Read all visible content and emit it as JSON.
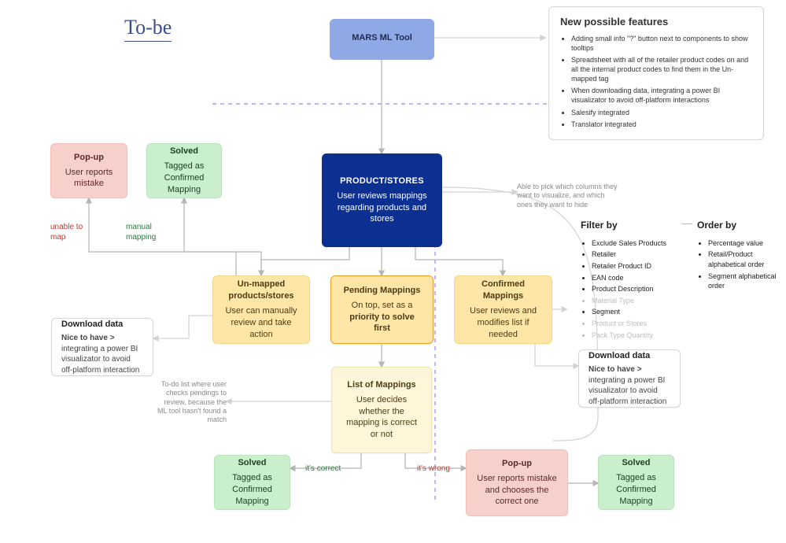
{
  "heading": "To-be",
  "nodes": {
    "mars": {
      "title": "MARS ML Tool",
      "desc": ""
    },
    "product": {
      "title": "PRODUCT/STORES",
      "desc": "User reviews mappings regarding products and stores"
    },
    "unmapped": {
      "title": "Un-mapped products/stores",
      "desc": "User can manually review and take action"
    },
    "pending": {
      "title": "Pending Mappings",
      "desc": "On top, set as a priority to solve first"
    },
    "confirmed": {
      "title": "Confirmed Mappings",
      "desc": "User reviews and modifies list if needed"
    },
    "list": {
      "title": "List of Mappings",
      "desc": "User decides whether the mapping is correct or not"
    },
    "popupL": {
      "title": "Pop-up",
      "desc": "User reports mistake"
    },
    "solvedTL": {
      "title": "Solved",
      "desc": "Tagged as Confirmed Mapping"
    },
    "solvedBL": {
      "title": "Solved",
      "desc": "Tagged as Confirmed Mapping"
    },
    "popupR": {
      "title": "Pop-up",
      "desc": "User reports mistake and chooses the correct one"
    },
    "solvedBR": {
      "title": "Solved",
      "desc": "Tagged as Confirmed Mapping"
    },
    "dlL": {
      "title": "Download data",
      "desc_prefix": "Nice to have > ",
      "desc": "integrating a power BI visualizator to avoid off-platform interaction"
    },
    "dlR": {
      "title": "Download data",
      "desc_prefix": "Nice to have > ",
      "desc": "integrating a power BI visualizator to avoid off-platform interaction"
    }
  },
  "edge_labels": {
    "unable": "unable to map",
    "manual": "manual mapping",
    "correct": "it's correct",
    "wrong": "it's wrong"
  },
  "annotations": {
    "columns": "Able to pick which columns they want to visualize, and which ones they want to hide",
    "todo": "To-do list where user checks pendings to review, because the ML tool hasn't found a match"
  },
  "features": {
    "title": "New possible features",
    "items": [
      "Adding small info \"?\" button next to components to show tooltips",
      "Spreadsheet with all of the retailer product codes on and all the internal product codes to find them in the Un-mapped tag",
      "When downloading data, integrating a power BI visualizator to avoid off-platform interactions",
      "Salesify integrated",
      "Translator integrated"
    ]
  },
  "filter": {
    "title": "Filter by",
    "items": [
      {
        "label": "Exclude Sales Products",
        "muted": false
      },
      {
        "label": "Retailer",
        "muted": false
      },
      {
        "label": "Retailer Product ID",
        "muted": false
      },
      {
        "label": "EAN code",
        "muted": false
      },
      {
        "label": "Product Description",
        "muted": false
      },
      {
        "label": "Material Type",
        "muted": true
      },
      {
        "label": "Segment",
        "muted": false
      },
      {
        "label": "Product or Stores",
        "muted": true
      },
      {
        "label": "Pack Type Quantity",
        "muted": true
      }
    ]
  },
  "order": {
    "title": "Order by",
    "items": [
      "Percentage value",
      "Retail/Product alphabetical order",
      "Segment alphabetical order"
    ]
  }
}
